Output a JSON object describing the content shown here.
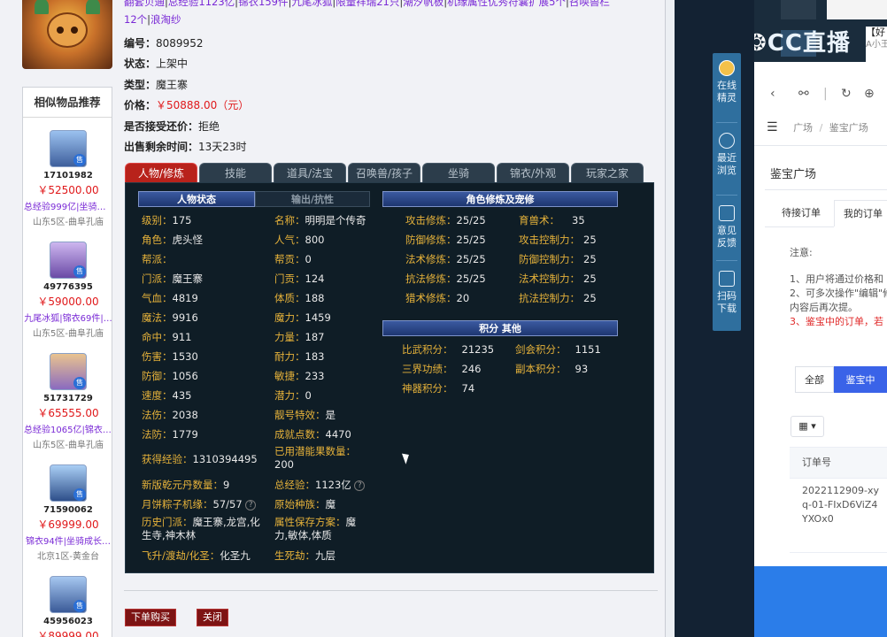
{
  "item": {
    "top_line_1": [
      "翻套贝通",
      "总经验1123亿",
      "锦衣159件",
      "九尾冰狐",
      "限量祥瑞21只",
      "潮汐帆板",
      "机缘属性优秀符囊扩展5个",
      "召唤兽栏"
    ],
    "top_line_2": [
      "12个",
      "浪淘纱"
    ],
    "id_label": "编号：",
    "id_value": "8089952",
    "status_label": "状态：",
    "status_value": "上架中",
    "type_label": "类型：",
    "type_value": "魔王寨",
    "price_label": "价格：",
    "price_value": "￥50888.00（元）",
    "bargain_label": "是否接受还价：",
    "bargain_value": "拒绝",
    "remaining_label": "出售剩余时间：",
    "remaining_value": "13天23时"
  },
  "recommend": {
    "title": "相似物品推荐",
    "items": [
      {
        "id": "17101982",
        "price": "￥52500.00",
        "desc": "总经验999亿|坐骑成…",
        "server": "山东5区-曲阜孔庙"
      },
      {
        "id": "49776395",
        "price": "￥59000.00",
        "desc": "九尾冰狐|锦衣69件|…",
        "server": "山东5区-曲阜孔庙"
      },
      {
        "id": "51731729",
        "price": "￥65555.00",
        "desc": "总经验1065亿|锦衣6…",
        "server": "山东5区-曲阜孔庙"
      },
      {
        "id": "71590062",
        "price": "￥69999.00",
        "desc": "锦衣94件|坐骑成长…",
        "server": "北京1区-黄金台"
      },
      {
        "id": "45956023",
        "price": "￥89999.00",
        "desc": "",
        "server": ""
      }
    ],
    "badge": "售"
  },
  "tabs": [
    "人物/修炼",
    "技能",
    "道具/法宝",
    "召唤兽/孩子",
    "坐骑",
    "锦衣/外观",
    "玩家之家"
  ],
  "panel": {
    "sec_status": "人物状态",
    "sec_output": "输出/抗性",
    "sec_cultivation": "角色修炼及宠修",
    "sec_points": "积分  其他",
    "left_stats": [
      {
        "k": "级别：",
        "v": "175"
      },
      {
        "k": "角色：",
        "v": "虎头怪"
      },
      {
        "k": "帮派：",
        "v": ""
      },
      {
        "k": "门派：",
        "v": "魔王寨"
      },
      {
        "k": "气血：",
        "v": "4819"
      },
      {
        "k": "魔法：",
        "v": "9916"
      },
      {
        "k": "命中：",
        "v": "911"
      },
      {
        "k": "伤害：",
        "v": "1530"
      },
      {
        "k": "防御：",
        "v": "1056"
      },
      {
        "k": "速度：",
        "v": "435"
      },
      {
        "k": "法伤：",
        "v": "2038"
      },
      {
        "k": "法防：",
        "v": "1779"
      }
    ],
    "mid_stats": [
      {
        "k": "名称：",
        "v": "明明是个传奇"
      },
      {
        "k": "人气：",
        "v": "800"
      },
      {
        "k": "帮贡：",
        "v": "0"
      },
      {
        "k": "门贡：",
        "v": "124"
      },
      {
        "k": "体质：",
        "v": "188"
      },
      {
        "k": "魔力：",
        "v": "1459"
      },
      {
        "k": "力量：",
        "v": "187"
      },
      {
        "k": "耐力：",
        "v": "183"
      },
      {
        "k": "敏捷：",
        "v": "233"
      },
      {
        "k": "潜力：",
        "v": "0"
      },
      {
        "k": "靓号特效：",
        "v": "是"
      },
      {
        "k": "成就点数：",
        "v": "4470"
      }
    ],
    "exp_label": "获得经验：",
    "exp_value": "1310394495",
    "potential_label": "已用潜能果数量：",
    "potential_value": "200",
    "qianyuan_label": "新版乾元丹数量：",
    "qianyuan_value": "9",
    "total_exp_label": "总经验：",
    "total_exp_value": "1123亿",
    "zongzi_label": "月饼粽子机缘：",
    "zongzi_value": "57/57",
    "origin_label": "原始种族：",
    "origin_value": "魔",
    "history_label": "历史门派：",
    "history_value": "魔王寨,龙宫,化生寺,神木林",
    "attr_plan_label": "属性保存方案：",
    "attr_plan_value": "魔力,敏体,体质",
    "feisheng_label": "飞升/渡劫/化圣：",
    "feisheng_value": "化圣九",
    "shengsi_label": "生死劫：",
    "shengsi_value": "九层",
    "cult": [
      {
        "k": "攻击修炼：",
        "v": "25/25",
        "k2": "育兽术：",
        "v2": "35"
      },
      {
        "k": "防御修炼：",
        "v": "25/25",
        "k2": "攻击控制力：",
        "v2": "25"
      },
      {
        "k": "法术修炼：",
        "v": "25/25",
        "k2": "防御控制力：",
        "v2": "25"
      },
      {
        "k": "抗法修炼：",
        "v": "25/25",
        "k2": "法术控制力：",
        "v2": "25"
      },
      {
        "k": "猎术修炼：",
        "v": "20",
        "k2": "抗法控制力：",
        "v2": "25"
      }
    ],
    "points": [
      {
        "k": "比武积分：",
        "v": "21235",
        "k2": "剑会积分：",
        "v2": "1151"
      },
      {
        "k": "三界功绩：",
        "v": "246",
        "k2": "副本积分：",
        "v2": "93"
      },
      {
        "k": "神器积分：",
        "v": "74",
        "k2": "",
        "v2": ""
      }
    ]
  },
  "buttons": {
    "buy": "下单购买",
    "close": "关闭"
  },
  "side_tools": [
    {
      "label": "在线精灵"
    },
    {
      "label": "最近浏览"
    },
    {
      "label": "意见反馈"
    },
    {
      "label": "扫码下载"
    }
  ],
  "right": {
    "logo": "CC直播",
    "title_snippet": "【好",
    "sub_snippet": "A小王",
    "crumb_1": "广场",
    "crumb_sep": "/",
    "crumb_2": "鉴宝广场",
    "page_title": "鉴宝广场",
    "tab_pending": "待接订单",
    "tab_mine": "我的订单",
    "notice_title": "注意:",
    "notice_1": "1、用户将通过价格和",
    "notice_2": "2、可多次操作\"编辑\"修",
    "notice_2b": "内容后再次提。",
    "notice_3": "3、鉴宝中的订单，若",
    "seg_all": "全部",
    "seg_active": "鉴宝中",
    "grid_label": "▾",
    "col_order": "订单号",
    "order_no": "2022112909-xyq-01-FIxD6ViZ4YXOx0"
  },
  "colors": {
    "accent_red": "#e0191b",
    "tab_active": "#b8221b",
    "panel_bg": "#0f1d26",
    "stat_key": "#e6b23a",
    "cc_blue": "#3a63e8"
  }
}
